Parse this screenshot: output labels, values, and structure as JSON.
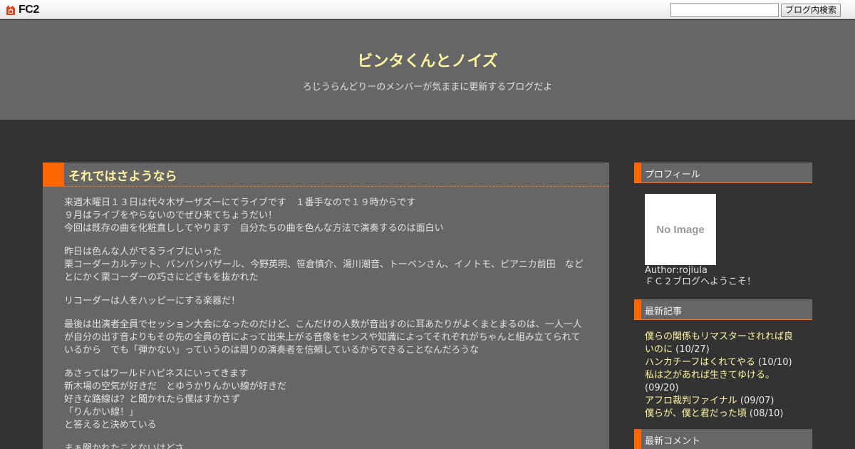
{
  "fc2bar": {
    "logo_text": "FC2",
    "search_placeholder": "",
    "search_button": "ブログ内検索"
  },
  "header": {
    "title": "ビンタくんとノイズ",
    "description": "ろじうらんどりーのメンバーが気ままに更新するブログだよ"
  },
  "entry": {
    "title": "それではさようなら",
    "paragraphs": [
      [
        "来週木曜日１３日は代々木ザーザズーにてライブです　１番手なので１９時からです",
        "９月はライブをやらないのでぜひ来てちょうだい！",
        "今回は既存の曲を化粧直ししてやります　自分たちの曲を色んな方法で演奏するのは面白い"
      ],
      [
        "昨日は色んな人がでるライブにいった",
        "栗コーダーカルテット、バンバンバザール、今野英明、笹倉慎介、湯川潮音、トーベンさん、イノトモ、ピアニカ前田　など",
        "とにかく栗コーダーの巧さにどぎもを抜かれた"
      ],
      [
        "リコーダーは人をハッピーにする楽器だ！"
      ],
      [
        "最後は出演者全員でセッション大会になったのだけど、こんだけの人数が音出すのに耳あたりがよくまとまるのは、一人一人",
        "が自分の出す音よりもその先の全員の音によって出来上がる音像をセンスや知識によってそれぞれがちゃんと組み立てられて",
        "いるから　でも「弾かない」っていうのは周りの演奏者を信頼しているからできることなんだろうな"
      ],
      [
        "あさってはワールドハピネスにいってきます",
        "新木場の空気が好きだ　とゆうかりんかい線が好きだ",
        "好きな路線は？と聞かれたら僕はすかさず",
        "「りんかい線！」",
        "と答えると決めている"
      ],
      [
        "まぁ聞かれたことないけどさ"
      ]
    ]
  },
  "sidebar": {
    "profile": {
      "heading": "プロフィール",
      "image_text": "No Image",
      "author": "Author:rojiula",
      "greeting": "ＦＣ２ブログへようこそ！"
    },
    "recent_posts": {
      "heading": "最新記事",
      "items": [
        {
          "title": "僕らの関係もリマスターされれば良いのに",
          "date": "(10/27)"
        },
        {
          "title": "ハンカチーフはくれてやる",
          "date": "(10/10)"
        },
        {
          "title": "私は之があれば生きてゆける。",
          "date": "(09/20)"
        },
        {
          "title": "アフロ裁判ファイナル",
          "date": "(09/07)"
        },
        {
          "title": "僕らが、僕と君だった頃",
          "date": "(08/10)"
        }
      ]
    },
    "recent_comments": {
      "heading": "最新コメント"
    }
  },
  "colors": {
    "accent": "#ff6600",
    "title_yellow": "#fff5a0",
    "panel": "#666666",
    "background": "#333333"
  }
}
